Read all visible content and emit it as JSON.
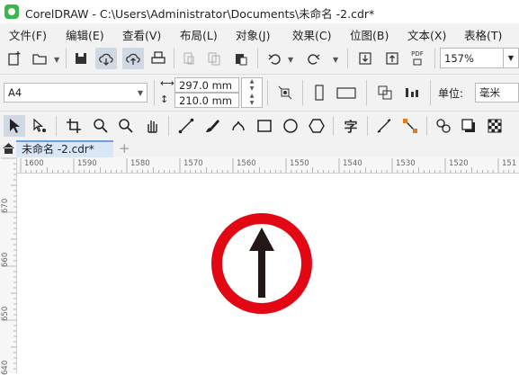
{
  "window": {
    "title": "CorelDRAW - C:\\Users\\Administrator\\Documents\\未命名 -2.cdr*"
  },
  "menu": [
    "文件(F)",
    "编辑(E)",
    "查看(V)",
    "布局(L)",
    "对象(J)",
    "效果(C)",
    "位图(B)",
    "文本(X)",
    "表格(T)"
  ],
  "toolbar1": {
    "zoom_value": "157%",
    "pdf_label": "PDF"
  },
  "toolbar2": {
    "page_size": "A4",
    "width": "297.0 mm",
    "height": "210.0 mm",
    "unit_label": "单位:",
    "unit_value": "毫米"
  },
  "toolbar3": {
    "text_tool_glyph": "字"
  },
  "tabs": {
    "document": "未命名 -2.cdr*",
    "add": "+"
  },
  "ruler": {
    "h_labels": [
      "1600",
      "1590",
      "1580",
      "1570",
      "1560",
      "1550",
      "1540",
      "1530",
      "1520",
      "151"
    ],
    "v_labels": [
      "670",
      "660",
      "650",
      "640"
    ]
  },
  "sign": {
    "ring_color": "#e30613",
    "arrow_color": "#231815"
  }
}
